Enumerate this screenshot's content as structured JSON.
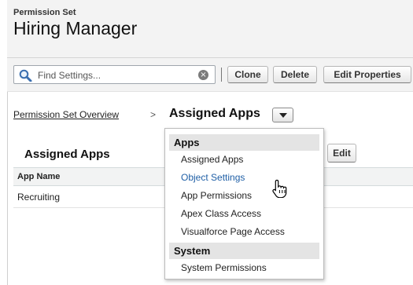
{
  "header": {
    "subtitle": "Permission Set",
    "title": "Hiring Manager"
  },
  "toolbar": {
    "search_placeholder": "Find Settings...",
    "clear_icon": "clear-icon",
    "search_icon": "magnifier-icon",
    "buttons": {
      "clone": "Clone",
      "delete": "Delete",
      "edit_properties": "Edit Properties"
    }
  },
  "breadcrumb": {
    "link": "Permission Set Overview",
    "separator": ">",
    "current": "Assigned Apps"
  },
  "section": {
    "title": "Assigned Apps",
    "edit_label": "Edit"
  },
  "table": {
    "header": "App Name",
    "rows": [
      "Recruiting"
    ]
  },
  "dropdown": {
    "groups": [
      {
        "label": "Apps",
        "items": [
          "Assigned Apps",
          "Object Settings",
          "App Permissions",
          "Apex Class Access",
          "Visualforce Page Access"
        ]
      },
      {
        "label": "System",
        "items": [
          "System Permissions"
        ]
      }
    ],
    "hovered_item": "Object Settings"
  },
  "colors": {
    "link_blue": "#1f5fa6",
    "header_bg": "#f3f3f3",
    "menu_group_bg": "#e4e4e4"
  }
}
